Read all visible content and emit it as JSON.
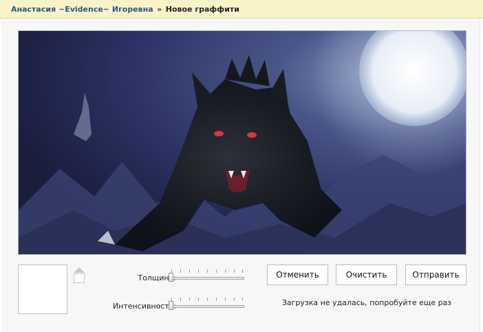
{
  "breadcrumb": {
    "user_name": "Анастасия ~Evidence~ Игоревна",
    "separator": "»",
    "page_title": "Новое граффити"
  },
  "tools": {
    "thickness_label": "Толщина:",
    "thickness_value": 0,
    "intensity_label": "Интенсивность:",
    "intensity_value": 0
  },
  "buttons": {
    "cancel": "Отменить",
    "clear": "Очистить",
    "send": "Отправить"
  },
  "status": {
    "message": "Загрузка не удалась, попробуйте еще раз"
  },
  "colors": {
    "header_bg": "#fbf3c8",
    "link": "#2b587a",
    "canvas_sky": "#2b3159",
    "moon": "#eef2f8"
  }
}
